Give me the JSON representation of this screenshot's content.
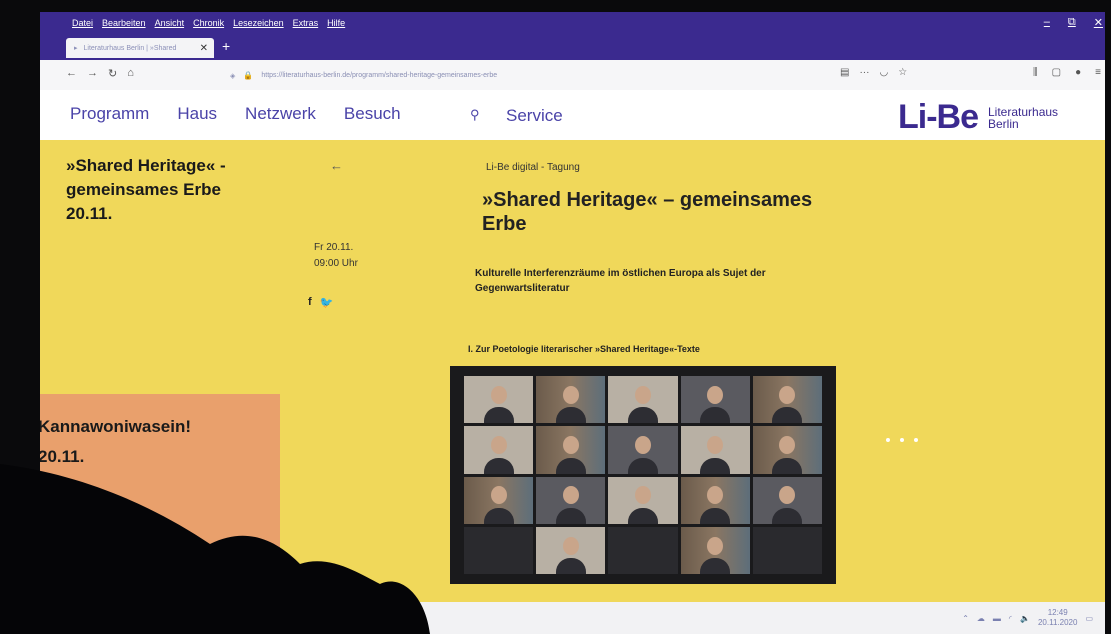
{
  "browser": {
    "menu": [
      "Datei",
      "Bearbeiten",
      "Ansicht",
      "Chronik",
      "Lesezeichen",
      "Extras",
      "Hilfe"
    ],
    "tab_title": "Literaturhaus Berlin | »Shared",
    "url": "https://literaturhaus-berlin.de/programm/shared-heritage-gemeinsames-erbe"
  },
  "site": {
    "nav": [
      "Programm",
      "Haus",
      "Netzwerk",
      "Besuch"
    ],
    "service": "Service",
    "logo_mark": "Li-Be",
    "logo_sub_1": "Literaturhaus",
    "logo_sub_2": "Berlin"
  },
  "sidebar": {
    "current_title_1": "»Shared Heritage« -",
    "current_title_2": "gemeinsames Erbe",
    "current_date": "20.11.",
    "next_title": "Kannawoniwasein!",
    "next_date": "20.11."
  },
  "event": {
    "back": "←",
    "date_line_1": "Fr 20.11.",
    "date_line_2": "09:00 Uhr",
    "share_facebook": "f",
    "share_twitter": "🐦",
    "kicker": "Li-Be digital - Tagung",
    "title_1": "»Shared Heritage« – gemeinsames",
    "title_2": "Erbe",
    "subtitle_1": "Kulturelle Interferenzräume im östlichen Europa als Sujet der",
    "subtitle_2": "Gegenwartsliteratur",
    "section": "I. Zur Poetologie literarischer »Shared Heritage«-Texte"
  },
  "taskbar": {
    "time": "12:49",
    "date": "20.11.2020"
  }
}
